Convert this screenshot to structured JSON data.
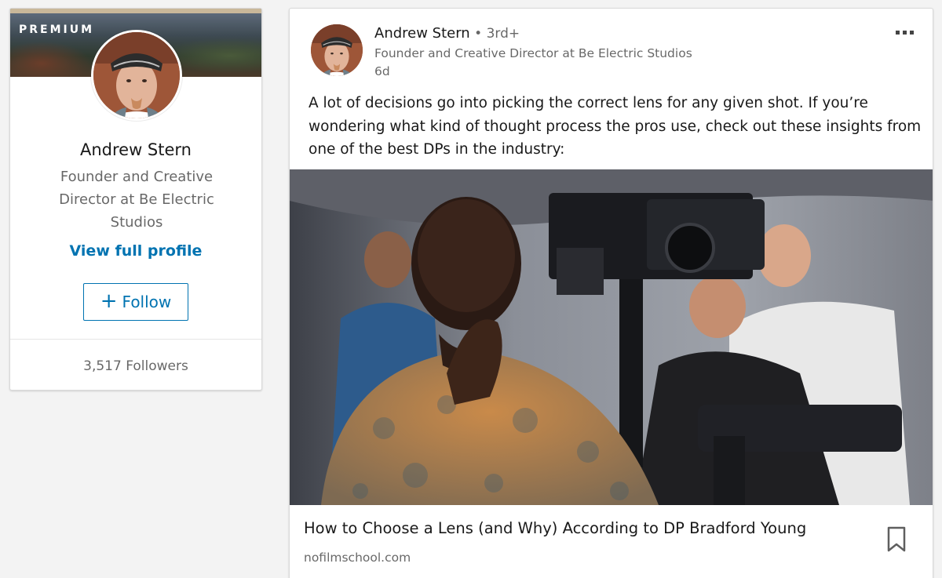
{
  "profile_card": {
    "premium_label": "PREMIUM",
    "name": "Andrew Stern",
    "headline": "Founder and Creative Director at Be Electric Studios",
    "view_profile_label": "View full profile",
    "follow_plus": "+",
    "follow_label": "Follow",
    "followers": "3,517 Followers"
  },
  "post": {
    "author_name": "Andrew Stern",
    "degree": " • 3rd+",
    "author_headline": "Founder and Creative Director at Be Electric Studios",
    "time": "6d",
    "text": "A lot of decisions go into picking the correct lens for any given shot. If you’re wondering what kind of thought process the pros use, check out these insights from one of the best DPs in the industry:",
    "article_title": "How to Choose a Lens (and Why) According to DP Bradford Young",
    "article_source": "nofilmschool.com"
  },
  "colors": {
    "accent": "#0073b1",
    "background": "#f3f3f3"
  },
  "icons": {
    "more": "more-dots-icon",
    "bookmark": "bookmark-icon",
    "plus": "plus-icon"
  }
}
